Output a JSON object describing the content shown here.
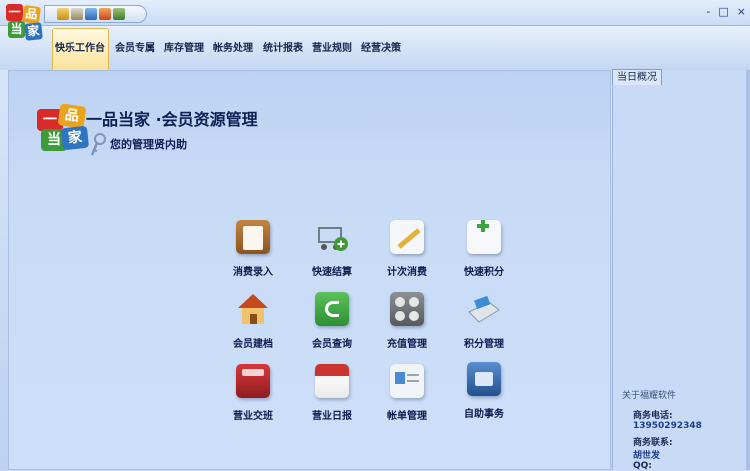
{
  "app": {
    "logo_chars": [
      "一",
      "品",
      "当",
      "家"
    ]
  },
  "window_controls": {
    "minimize": "-",
    "maximize": "□",
    "close": "×"
  },
  "ribbon": {
    "tabs": [
      "快乐工作台",
      "会员专属",
      "库存管理",
      "帐务处理",
      "统计报表",
      "营业规则",
      "经营决策"
    ]
  },
  "brand": {
    "logo_chars": [
      "一",
      "品",
      "当",
      "家"
    ],
    "title": "一品当家 ·会员资源管理",
    "subtitle": "您的管理贤内助"
  },
  "tiles": [
    {
      "label": "消费录入",
      "icon": "clipboard-icon",
      "color": "#a0652a"
    },
    {
      "label": "快速结算",
      "icon": "cart-add-icon",
      "color": "#7d8f9b"
    },
    {
      "label": "计次消费",
      "icon": "notepad-pencil-icon",
      "color": "#e9edf2"
    },
    {
      "label": "快速积分",
      "icon": "document-plus-icon",
      "color": "#f0f3f6"
    },
    {
      "label": "会员建档",
      "icon": "house-icon",
      "color": "#d88a2b"
    },
    {
      "label": "会员查询",
      "icon": "phone-icon",
      "color": "#3aa53e"
    },
    {
      "label": "充值管理",
      "icon": "calculator-icon",
      "color": "#6c6f73"
    },
    {
      "label": "积分管理",
      "icon": "card-machine-icon",
      "color": "#cfd8df"
    },
    {
      "label": "营业交班",
      "icon": "register-icon",
      "color": "#b8262a"
    },
    {
      "label": "营业日报",
      "icon": "calendar-icon",
      "color": "#c9342f"
    },
    {
      "label": "帐单管理",
      "icon": "bill-document-icon",
      "color": "#e3e8ee"
    },
    {
      "label": "自助事务",
      "icon": "telephone-icon",
      "color": "#3f6fa8"
    }
  ],
  "right_panel": {
    "tab": "当日概况",
    "about": "关于福耀软件",
    "phone_label": "商务电话:",
    "phone": "13950292348",
    "contact_label": "商务联系:",
    "contact": "胡世发",
    "qq_label": "QQ:"
  }
}
